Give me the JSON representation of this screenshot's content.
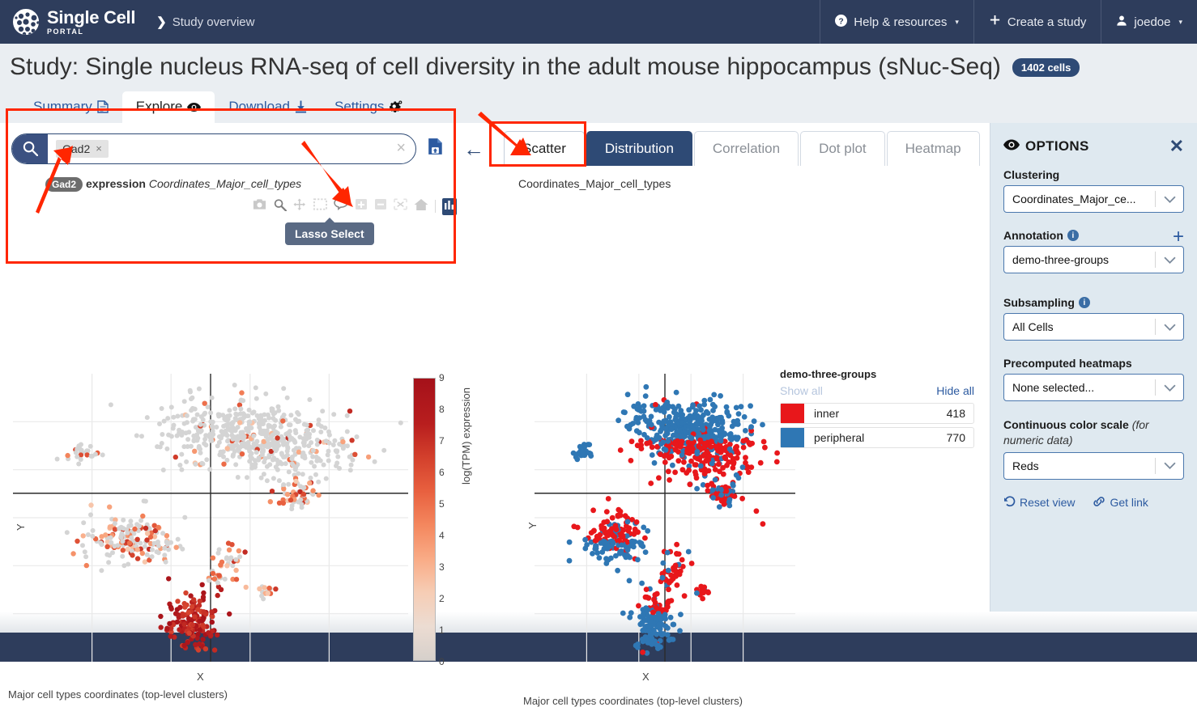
{
  "brand": {
    "title": "Single Cell",
    "subtitle": "PORTAL",
    "logo_icon": "cell-cluster-logo"
  },
  "topnav": {
    "breadcrumb": "Study overview",
    "breadcrumb_icon": "chevron-right-icon",
    "items": [
      {
        "label": "Help & resources",
        "icon": "question-circle-icon",
        "caret": "▾"
      },
      {
        "label": "Create a study",
        "icon": "plus-icon",
        "caret": ""
      },
      {
        "label": "joedoe",
        "icon": "user-icon",
        "caret": "▾"
      }
    ]
  },
  "header": {
    "page_title": "Study: Single nucleus RNA-seq of cell diversity in the adult mouse hippocampus (sNuc-Seq)",
    "cell_badge": "1402 cells"
  },
  "study_tabs": [
    {
      "label": "Summary",
      "icon": "document-icon",
      "active": false
    },
    {
      "label": "Explore",
      "icon": "eye-icon",
      "active": true
    },
    {
      "label": "Download",
      "icon": "download-icon",
      "active": false
    },
    {
      "label": "Settings",
      "icon": "gear-icon",
      "active": false
    }
  ],
  "search": {
    "icon": "search-icon",
    "tags": [
      {
        "label": "Gad2",
        "remove": "×"
      }
    ],
    "placeholder": "",
    "clear_label": "×",
    "upload_icon": "file-upload-icon",
    "back_icon": "arrow-left-icon"
  },
  "plot_tabs": [
    {
      "label": "Scatter",
      "state": "current"
    },
    {
      "label": "Distribution",
      "state": "selected"
    },
    {
      "label": "Correlation",
      "state": "normal"
    },
    {
      "label": "Dot plot",
      "state": "normal"
    },
    {
      "label": "Heatmap",
      "state": "normal"
    }
  ],
  "left_plot": {
    "gene_chip": "Gad2",
    "title_bold": "expression",
    "title_italic": "Coordinates_Major_cell_types",
    "xlabel": "X",
    "ylabel": "Y",
    "caption": "Major cell types coordinates (top-level clusters)",
    "colorbar_title": "log(TPM) expression",
    "colorbar_ticks": [
      "9",
      "8",
      "7",
      "6",
      "5",
      "4",
      "3",
      "2",
      "1",
      "0"
    ],
    "modebar": [
      "camera-icon",
      "zoom-icon",
      "pan-icon",
      "box-select-icon",
      "lasso-select-icon",
      "zoom-in-icon",
      "zoom-out-icon",
      "autoscale-icon",
      "home-reset-icon",
      "plotly-logo-icon"
    ],
    "tooltip": "Lasso Select"
  },
  "right_plot": {
    "title": "Coordinates_Major_cell_types",
    "xlabel": "X",
    "ylabel": "Y",
    "caption": "Major cell types coordinates (top-level clusters)"
  },
  "legend": {
    "title": "demo-three-groups",
    "show_all": "Show all",
    "hide_all": "Hide all",
    "entries": [
      {
        "label": "inner",
        "count": "418",
        "color": "#e8171b"
      },
      {
        "label": "peripheral",
        "count": "770",
        "color": "#2f77b4"
      }
    ]
  },
  "options": {
    "icon": "eye-icon",
    "title": "OPTIONS",
    "close": "✕",
    "clustering": {
      "label": "Clustering",
      "value": "Coordinates_Major_ce..."
    },
    "annotation": {
      "label": "Annotation",
      "value": "demo-three-groups",
      "add": "+"
    },
    "subsampling": {
      "label": "Subsampling",
      "value": "All Cells"
    },
    "heatmaps": {
      "label": "Precomputed heatmaps",
      "value": "None selected..."
    },
    "color_scale": {
      "label": "Continuous color scale",
      "note": "(for numeric data)",
      "value": "Reds"
    },
    "links": [
      {
        "label": "Reset view",
        "icon": "undo-icon"
      },
      {
        "label": "Get link",
        "icon": "link-icon"
      }
    ]
  },
  "colors": {
    "navy": "#2e3d5c",
    "accent_blue": "#2c5aa0",
    "panel_bg": "#dfe9f0",
    "annotation_red": "#ff2600",
    "inner": "#e8171b",
    "peripheral": "#2f77b4"
  },
  "chart_data": {
    "type": "scatter",
    "title": "Gad2 expression Coordinates_Major_cell_types",
    "xlabel": "X",
    "ylabel": "Y",
    "colorbar": {
      "label": "log(TPM) expression",
      "min": 0,
      "max": 9,
      "scale": "Reds"
    },
    "n_cells": 1402,
    "annotation": "demo-three-groups",
    "groups": [
      {
        "name": "inner",
        "count": 418,
        "color": "#e8171b"
      },
      {
        "name": "peripheral",
        "count": 770,
        "color": "#2f77b4"
      }
    ],
    "clusters": [
      {
        "id": "top-right-dense",
        "cx": 0.63,
        "cy": 0.76,
        "n": 520,
        "expr": "low"
      },
      {
        "id": "far-left-small",
        "cx": 0.2,
        "cy": 0.7,
        "n": 22,
        "expr": "low"
      },
      {
        "id": "mid-left",
        "cx": 0.3,
        "cy": 0.42,
        "n": 150,
        "expr": "mid"
      },
      {
        "id": "bottom-center-red",
        "cx": 0.45,
        "cy": 0.14,
        "n": 130,
        "expr": "high"
      },
      {
        "id": "scattered-mid",
        "cx": 0.56,
        "cy": 0.36,
        "n": 60,
        "expr": "mid"
      },
      {
        "id": "lower-right-arc",
        "cx": 0.72,
        "cy": 0.58,
        "n": 45,
        "expr": "mid"
      }
    ]
  }
}
